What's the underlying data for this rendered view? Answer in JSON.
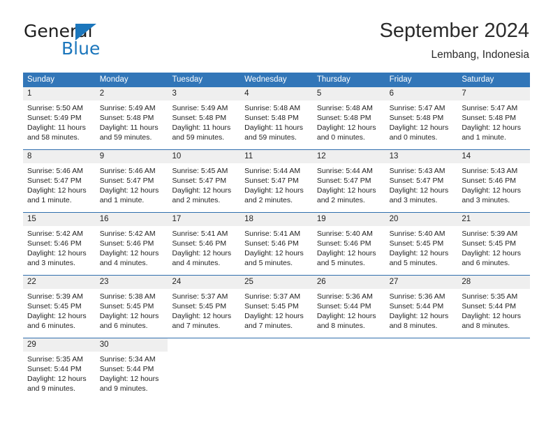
{
  "brand": {
    "word1": "General",
    "word2": "Blue",
    "flag_color": "#1b76bc"
  },
  "header": {
    "title": "September 2024",
    "location": "Lembang, Indonesia"
  },
  "theme": {
    "header_blue": "#3276b8",
    "separator_blue": "#2f6ead",
    "day_band_gray": "#efefef"
  },
  "calendar": {
    "weekday_headers": [
      "Sunday",
      "Monday",
      "Tuesday",
      "Wednesday",
      "Thursday",
      "Friday",
      "Saturday"
    ],
    "weeks": [
      [
        {
          "day": "1",
          "sunrise": "Sunrise: 5:50 AM",
          "sunset": "Sunset: 5:49 PM",
          "daylight": "Daylight: 11 hours and 58 minutes."
        },
        {
          "day": "2",
          "sunrise": "Sunrise: 5:49 AM",
          "sunset": "Sunset: 5:48 PM",
          "daylight": "Daylight: 11 hours and 59 minutes."
        },
        {
          "day": "3",
          "sunrise": "Sunrise: 5:49 AM",
          "sunset": "Sunset: 5:48 PM",
          "daylight": "Daylight: 11 hours and 59 minutes."
        },
        {
          "day": "4",
          "sunrise": "Sunrise: 5:48 AM",
          "sunset": "Sunset: 5:48 PM",
          "daylight": "Daylight: 11 hours and 59 minutes."
        },
        {
          "day": "5",
          "sunrise": "Sunrise: 5:48 AM",
          "sunset": "Sunset: 5:48 PM",
          "daylight": "Daylight: 12 hours and 0 minutes."
        },
        {
          "day": "6",
          "sunrise": "Sunrise: 5:47 AM",
          "sunset": "Sunset: 5:48 PM",
          "daylight": "Daylight: 12 hours and 0 minutes."
        },
        {
          "day": "7",
          "sunrise": "Sunrise: 5:47 AM",
          "sunset": "Sunset: 5:48 PM",
          "daylight": "Daylight: 12 hours and 1 minute."
        }
      ],
      [
        {
          "day": "8",
          "sunrise": "Sunrise: 5:46 AM",
          "sunset": "Sunset: 5:47 PM",
          "daylight": "Daylight: 12 hours and 1 minute."
        },
        {
          "day": "9",
          "sunrise": "Sunrise: 5:46 AM",
          "sunset": "Sunset: 5:47 PM",
          "daylight": "Daylight: 12 hours and 1 minute."
        },
        {
          "day": "10",
          "sunrise": "Sunrise: 5:45 AM",
          "sunset": "Sunset: 5:47 PM",
          "daylight": "Daylight: 12 hours and 2 minutes."
        },
        {
          "day": "11",
          "sunrise": "Sunrise: 5:44 AM",
          "sunset": "Sunset: 5:47 PM",
          "daylight": "Daylight: 12 hours and 2 minutes."
        },
        {
          "day": "12",
          "sunrise": "Sunrise: 5:44 AM",
          "sunset": "Sunset: 5:47 PM",
          "daylight": "Daylight: 12 hours and 2 minutes."
        },
        {
          "day": "13",
          "sunrise": "Sunrise: 5:43 AM",
          "sunset": "Sunset: 5:47 PM",
          "daylight": "Daylight: 12 hours and 3 minutes."
        },
        {
          "day": "14",
          "sunrise": "Sunrise: 5:43 AM",
          "sunset": "Sunset: 5:46 PM",
          "daylight": "Daylight: 12 hours and 3 minutes."
        }
      ],
      [
        {
          "day": "15",
          "sunrise": "Sunrise: 5:42 AM",
          "sunset": "Sunset: 5:46 PM",
          "daylight": "Daylight: 12 hours and 3 minutes."
        },
        {
          "day": "16",
          "sunrise": "Sunrise: 5:42 AM",
          "sunset": "Sunset: 5:46 PM",
          "daylight": "Daylight: 12 hours and 4 minutes."
        },
        {
          "day": "17",
          "sunrise": "Sunrise: 5:41 AM",
          "sunset": "Sunset: 5:46 PM",
          "daylight": "Daylight: 12 hours and 4 minutes."
        },
        {
          "day": "18",
          "sunrise": "Sunrise: 5:41 AM",
          "sunset": "Sunset: 5:46 PM",
          "daylight": "Daylight: 12 hours and 5 minutes."
        },
        {
          "day": "19",
          "sunrise": "Sunrise: 5:40 AM",
          "sunset": "Sunset: 5:46 PM",
          "daylight": "Daylight: 12 hours and 5 minutes."
        },
        {
          "day": "20",
          "sunrise": "Sunrise: 5:40 AM",
          "sunset": "Sunset: 5:45 PM",
          "daylight": "Daylight: 12 hours and 5 minutes."
        },
        {
          "day": "21",
          "sunrise": "Sunrise: 5:39 AM",
          "sunset": "Sunset: 5:45 PM",
          "daylight": "Daylight: 12 hours and 6 minutes."
        }
      ],
      [
        {
          "day": "22",
          "sunrise": "Sunrise: 5:39 AM",
          "sunset": "Sunset: 5:45 PM",
          "daylight": "Daylight: 12 hours and 6 minutes."
        },
        {
          "day": "23",
          "sunrise": "Sunrise: 5:38 AM",
          "sunset": "Sunset: 5:45 PM",
          "daylight": "Daylight: 12 hours and 6 minutes."
        },
        {
          "day": "24",
          "sunrise": "Sunrise: 5:37 AM",
          "sunset": "Sunset: 5:45 PM",
          "daylight": "Daylight: 12 hours and 7 minutes."
        },
        {
          "day": "25",
          "sunrise": "Sunrise: 5:37 AM",
          "sunset": "Sunset: 5:45 PM",
          "daylight": "Daylight: 12 hours and 7 minutes."
        },
        {
          "day": "26",
          "sunrise": "Sunrise: 5:36 AM",
          "sunset": "Sunset: 5:44 PM",
          "daylight": "Daylight: 12 hours and 8 minutes."
        },
        {
          "day": "27",
          "sunrise": "Sunrise: 5:36 AM",
          "sunset": "Sunset: 5:44 PM",
          "daylight": "Daylight: 12 hours and 8 minutes."
        },
        {
          "day": "28",
          "sunrise": "Sunrise: 5:35 AM",
          "sunset": "Sunset: 5:44 PM",
          "daylight": "Daylight: 12 hours and 8 minutes."
        }
      ],
      [
        {
          "day": "29",
          "sunrise": "Sunrise: 5:35 AM",
          "sunset": "Sunset: 5:44 PM",
          "daylight": "Daylight: 12 hours and 9 minutes."
        },
        {
          "day": "30",
          "sunrise": "Sunrise: 5:34 AM",
          "sunset": "Sunset: 5:44 PM",
          "daylight": "Daylight: 12 hours and 9 minutes."
        },
        {
          "day": "",
          "sunrise": "",
          "sunset": "",
          "daylight": ""
        },
        {
          "day": "",
          "sunrise": "",
          "sunset": "",
          "daylight": ""
        },
        {
          "day": "",
          "sunrise": "",
          "sunset": "",
          "daylight": ""
        },
        {
          "day": "",
          "sunrise": "",
          "sunset": "",
          "daylight": ""
        },
        {
          "day": "",
          "sunrise": "",
          "sunset": "",
          "daylight": ""
        }
      ]
    ]
  }
}
